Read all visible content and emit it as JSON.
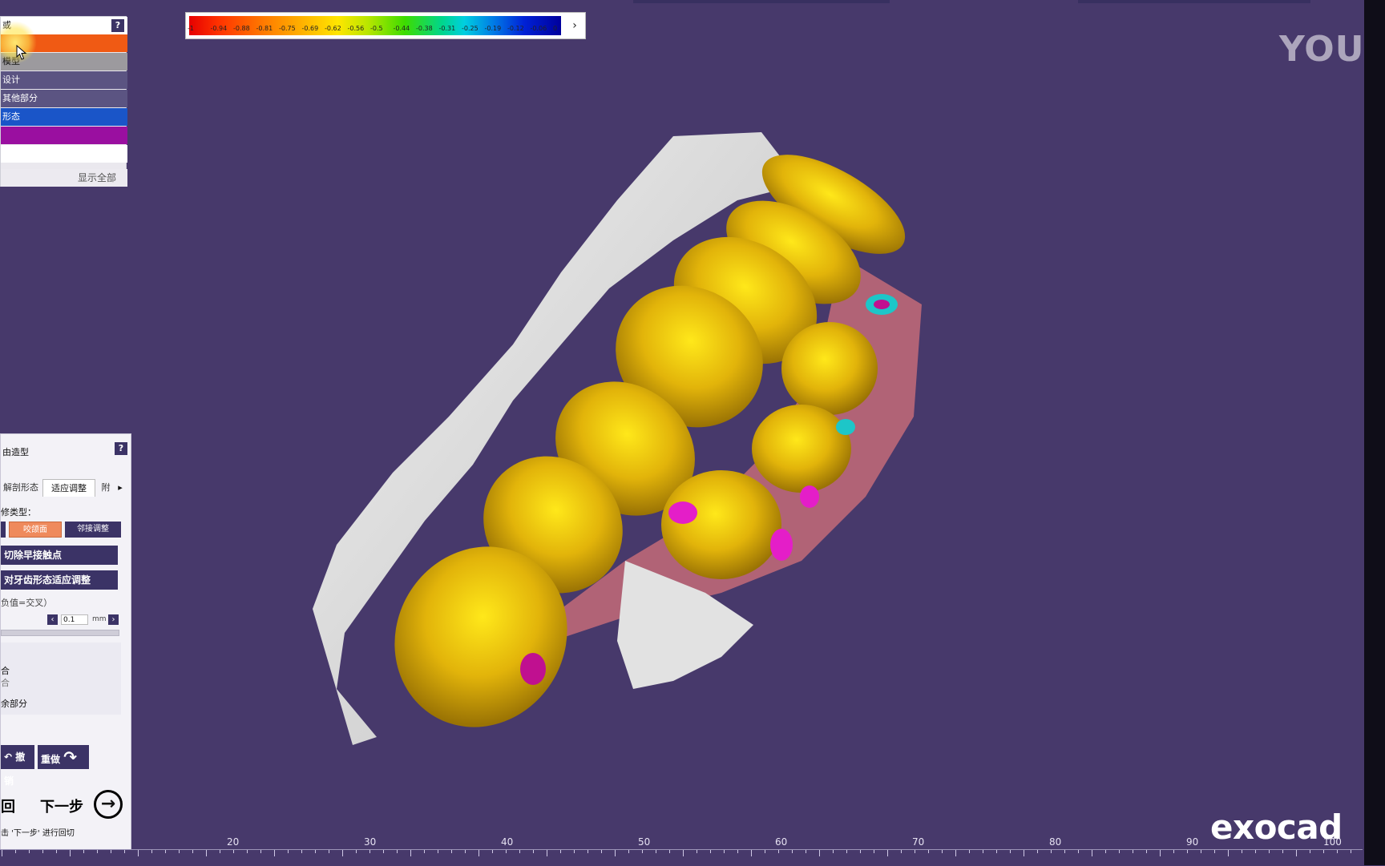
{
  "visibility_panel": {
    "header": "或",
    "help": "?",
    "rows": [
      {
        "label": "",
        "color": "#f05a14"
      },
      {
        "label": "模型",
        "color": "#9c9a9e"
      },
      {
        "label": "设计",
        "color": "#5b5482"
      },
      {
        "label": "其他部分",
        "color": "#5b5482"
      },
      {
        "label": "形态",
        "color": "#1a55c8"
      },
      {
        "label": "",
        "color": "#9a0fa0"
      },
      {
        "label": "",
        "color": "#ffffff"
      }
    ],
    "show_all": "显示全部"
  },
  "color_scale": {
    "labels": [
      "-1",
      "-0.94",
      "-0.88",
      "-0.81",
      "-0.75",
      "-0.69",
      "-0.62",
      "-0.56",
      "-0.5",
      "-0.44",
      "-0.38",
      "-0.31",
      "-0.25",
      "-0.19",
      "-0.12",
      "-0.06",
      "0"
    ],
    "arrow": "›"
  },
  "design_panel": {
    "title": "由造型",
    "help": "?",
    "tabs": [
      "解剖形态",
      "适应调整",
      "附"
    ],
    "tab_arrow": "▸",
    "type_label": "修类型：",
    "modes": [
      "",
      "咬颌面",
      "邻接调整"
    ],
    "btn_cut": "切除早接触点",
    "btn_adapt": "对牙齿形态适应调整",
    "neg_note": "负值=交叉）",
    "distance_value": "0.1",
    "distance_unit": "mm",
    "opt1": "合",
    "opt2": "合",
    "opt3": "余部分",
    "undo": "撤销",
    "redo": "重做",
    "back": "回",
    "next": "下一步",
    "hint": "击 '下一步' 进行回切"
  },
  "ruler": {
    "labels": [
      "20",
      "30",
      "40",
      "50",
      "60",
      "70",
      "80",
      "90",
      "100"
    ]
  },
  "watermarks": {
    "youku": "YOUK",
    "brand": "exocad"
  }
}
